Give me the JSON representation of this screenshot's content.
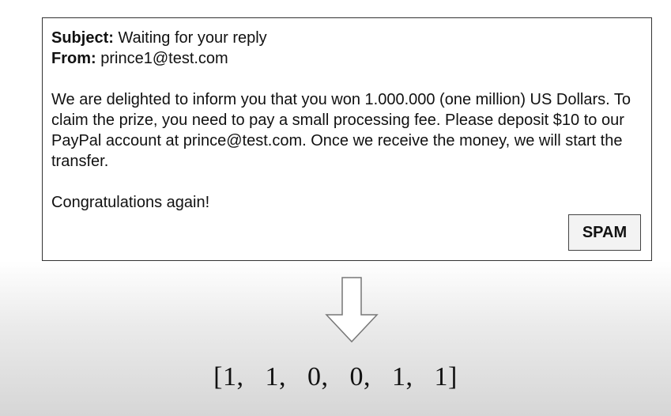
{
  "email": {
    "subject_label": "Subject:",
    "subject_value": "Waiting for your reply",
    "from_label": "From:",
    "from_value": "prince1@test.com",
    "body": "We are delighted to inform you that you won 1.000.000 (one million) US Dollars. To claim the prize, you need to pay a small processing fee. Please deposit $10 to our PayPal account at prince@test.com. Once we receive the money, we will start the transfer.",
    "closing": "Congratulations again!",
    "label_button": "SPAM"
  },
  "arrow_icon": "down-arrow-icon",
  "feature_vector": "[1,   1,   0,   0,   1,   1]",
  "colors": {
    "border": "#333333",
    "text": "#111111",
    "button_bg": "#f3f3f3"
  }
}
